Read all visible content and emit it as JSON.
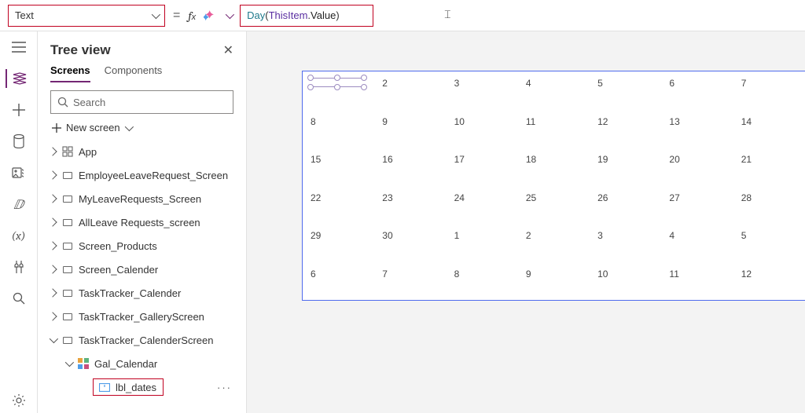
{
  "formula_bar": {
    "property": "Text",
    "fn": "Day",
    "open": "(",
    "kw": "ThisItem",
    "dot": ".",
    "prop": "Value",
    "close": ")"
  },
  "tree": {
    "title": "Tree view",
    "tabs": {
      "screens": "Screens",
      "components": "Components"
    },
    "search_placeholder": "Search",
    "new_screen": "New screen",
    "items": [
      {
        "label": "App",
        "kind": "app",
        "caret": "right"
      },
      {
        "label": "EmployeeLeaveRequest_Screen",
        "kind": "screen",
        "caret": "right"
      },
      {
        "label": "MyLeaveRequests_Screen",
        "kind": "screen",
        "caret": "right"
      },
      {
        "label": "AllLeave Requests_screen",
        "kind": "screen",
        "caret": "right"
      },
      {
        "label": "Screen_Products",
        "kind": "screen",
        "caret": "right"
      },
      {
        "label": "Screen_Calender",
        "kind": "screen",
        "caret": "right"
      },
      {
        "label": "TaskTracker_Calender",
        "kind": "screen",
        "caret": "right"
      },
      {
        "label": "TaskTracker_GalleryScreen",
        "kind": "screen",
        "caret": "right"
      },
      {
        "label": "TaskTracker_CalenderScreen",
        "kind": "screen",
        "caret": "down"
      },
      {
        "label": "Gal_Calendar",
        "kind": "gallery",
        "caret": "down",
        "indent": 2
      },
      {
        "label": "lbl_dates",
        "kind": "label",
        "indent": 3,
        "selected": true
      }
    ]
  },
  "calendar": {
    "rows": [
      [
        "sel",
        "2",
        "3",
        "4",
        "5",
        "6",
        "7"
      ],
      [
        "8",
        "9",
        "10",
        "11",
        "12",
        "13",
        "14"
      ],
      [
        "15",
        "16",
        "17",
        "18",
        "19",
        "20",
        "21"
      ],
      [
        "22",
        "23",
        "24",
        "25",
        "26",
        "27",
        "28"
      ],
      [
        "29",
        "30",
        "1",
        "2",
        "3",
        "4",
        "5"
      ],
      [
        "6",
        "7",
        "8",
        "9",
        "10",
        "11",
        "12"
      ]
    ]
  }
}
